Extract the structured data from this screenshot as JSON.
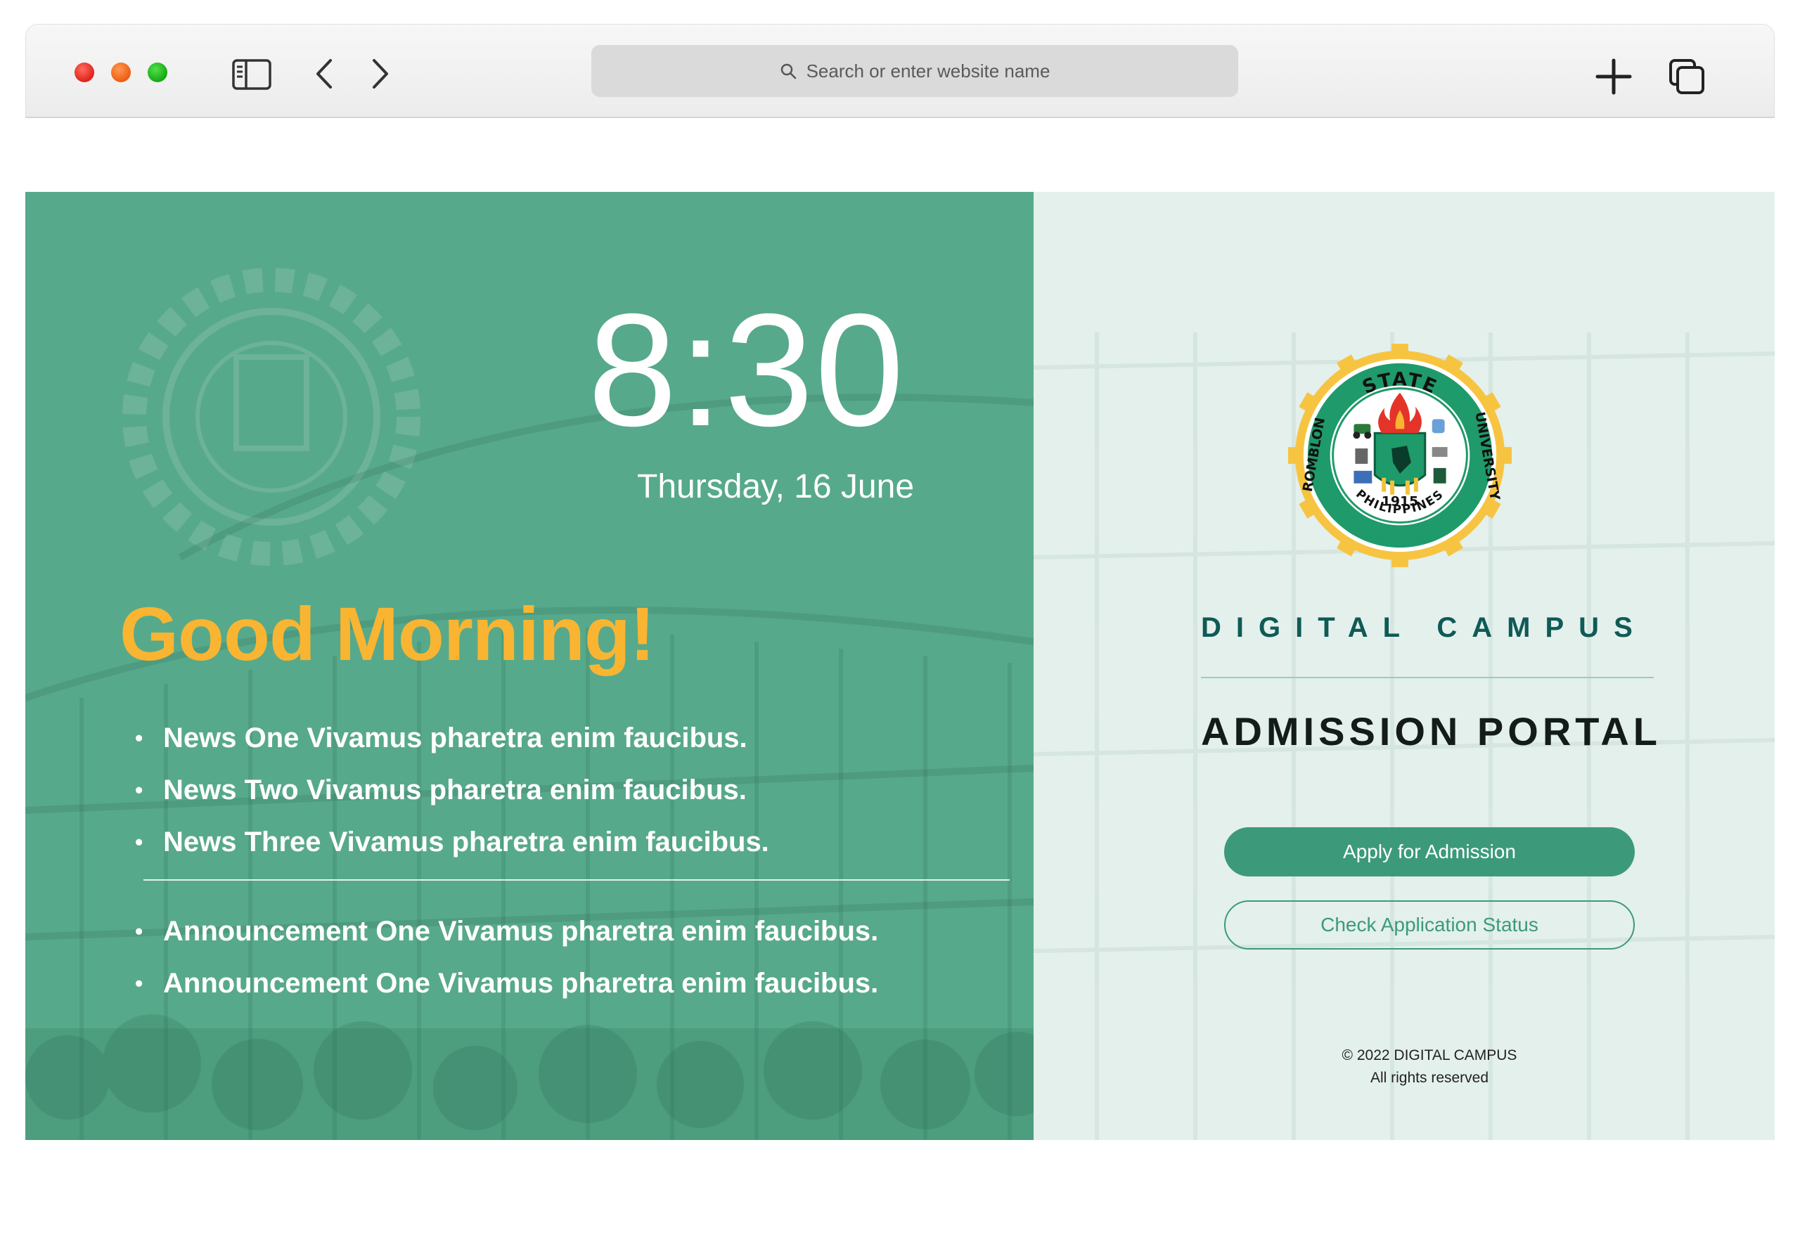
{
  "browser": {
    "address_placeholder": "Search or enter website name",
    "icons": [
      "sidebar-icon",
      "back-icon",
      "forward-icon",
      "search-icon",
      "new-tab-icon",
      "tabs-overview-icon"
    ]
  },
  "hero": {
    "time": "8:30",
    "date": "Thursday, 16 June",
    "greeting": "Good Morning!",
    "news": [
      "News One Vivamus pharetra enim faucibus.",
      "News Two Vivamus pharetra enim faucibus.",
      "News Three Vivamus pharetra enim faucibus."
    ],
    "announcements": [
      "Announcement One Vivamus pharetra enim faucibus.",
      "Announcement One Vivamus pharetra enim faucibus."
    ]
  },
  "logo": {
    "top_text": "STATE",
    "left_text": "ROMBLON",
    "right_text": "UNIVERSITY",
    "bottom_text": "PHILIPPINES",
    "year": "1915"
  },
  "portal": {
    "brand": "DIGITAL CAMPUS",
    "title": "ADMISSION PORTAL",
    "apply_label": "Apply for Admission",
    "status_label": "Check Application Status",
    "copyright": "© 2022 DIGITAL CAMPUS",
    "rights": "All rights reserved"
  },
  "colors": {
    "left_panel": "#57a98b",
    "right_panel": "#e4f0ec",
    "greeting": "#f9b531",
    "button": "#3c9a7b",
    "brand_text": "#0f5a56"
  }
}
